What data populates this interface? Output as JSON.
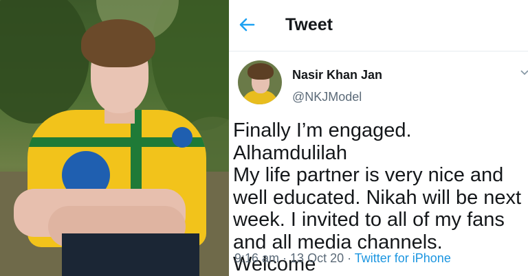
{
  "header": {
    "title": "Tweet",
    "back_icon": "arrow-left-icon",
    "accent": "#1da1f2"
  },
  "tweet": {
    "author_name": "Nasir Khan Jan",
    "author_handle": "@NKJModel",
    "text": "Finally I’m engaged. Alhamdulilah\nMy life partner is very nice and\nwell educated. Nikah will be next\nweek. I invited to all of my fans\nand all media channels. Welcome",
    "time": "9:16 am",
    "date": "13 Oct 20",
    "separator": " · ",
    "source": "Twitter for iPhone",
    "source_color": "#1b95e0"
  },
  "photo": {
    "description_icon": "profile-photo"
  }
}
